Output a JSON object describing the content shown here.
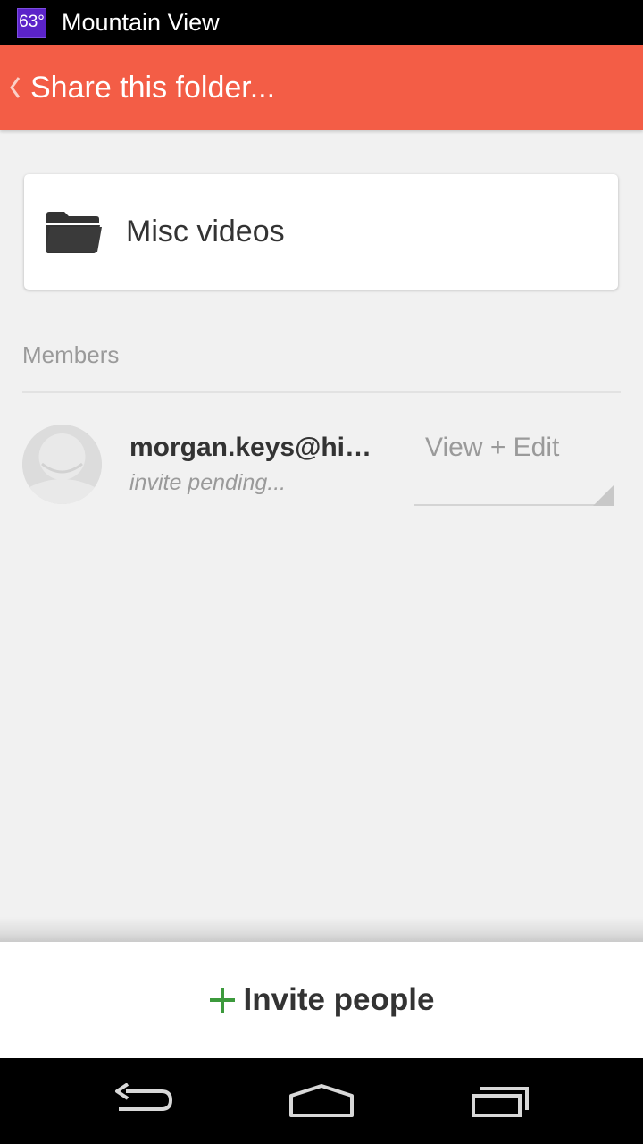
{
  "status_bar": {
    "weather": "63°",
    "location": "Mountain View"
  },
  "action_bar": {
    "title": "Share this folder...",
    "back_icon": "chevron-left-icon"
  },
  "folder": {
    "name": "Misc videos",
    "icon": "folder-icon"
  },
  "members": {
    "section_label": "Members",
    "items": [
      {
        "email": "morgan.keys@hi…",
        "status": "invite pending...",
        "permission": "View + Edit"
      }
    ]
  },
  "invite": {
    "label": "Invite people",
    "icon": "plus-icon"
  },
  "nav_bar": {
    "buttons": [
      "back-icon",
      "home-icon",
      "recents-icon"
    ]
  },
  "colors": {
    "accent": "#f35d46",
    "plus": "#3c9a3c",
    "weather_badge": "#5b23c9"
  }
}
